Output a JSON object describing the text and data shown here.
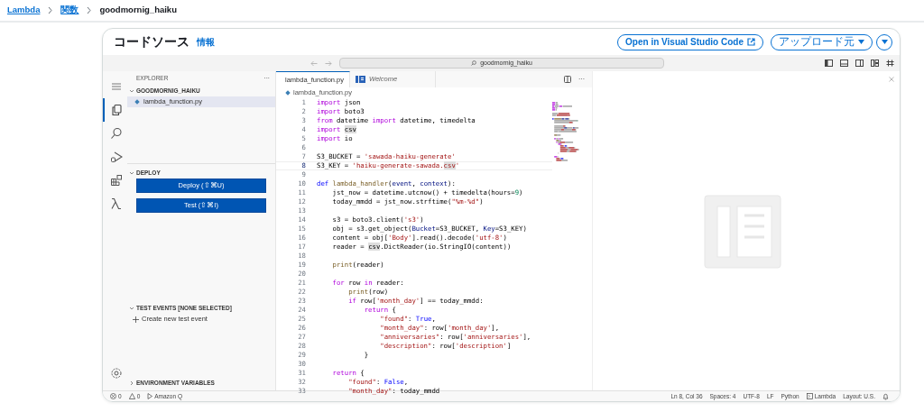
{
  "breadcrumb": [
    {
      "label": "Lambda",
      "link": true
    },
    {
      "label": "関数",
      "link": true
    },
    {
      "label": "goodmornig_haiku",
      "link": false
    }
  ],
  "panel": {
    "title": "コードソース",
    "info_link": "情報",
    "buttons": [
      {
        "kind": "external",
        "label": "Open in Visual Studio Code"
      },
      {
        "kind": "dropdown",
        "label": "アップロード元"
      },
      {
        "kind": "icon-dropdown"
      }
    ]
  },
  "ide": {
    "search": "goodmornig_haiku",
    "activity_bar": [
      {
        "kind": "menu",
        "selected": false
      },
      {
        "kind": "files",
        "selected": true
      },
      {
        "kind": "search",
        "selected": false
      },
      {
        "kind": "run",
        "selected": false
      },
      {
        "kind": "extensions",
        "selected": false
      },
      {
        "kind": "lambda",
        "selected": false
      },
      {
        "kind": "settings",
        "selected": false
      }
    ],
    "explorer": {
      "title": "EXPLORER",
      "more": "···",
      "sections": [
        {
          "kind": "files",
          "title": "GOODMORNIG_HAIKU",
          "expanded": true,
          "items": [
            {
              "label": "lambda_function.py",
              "selected": true
            }
          ]
        },
        {
          "kind": "buttons",
          "title": "DEPLOY",
          "expanded": true,
          "items": [
            {
              "label": "Deploy (⇧⌘U)"
            },
            {
              "label": "Test (⇧⌘I)"
            }
          ]
        },
        {
          "kind": "actions",
          "title": "TEST EVENTS [NONE SELECTED]",
          "expanded": true,
          "items": [
            {
              "label": "Create new test event"
            }
          ]
        },
        {
          "kind": "collapsed",
          "title": "ENVIRONMENT VARIABLES",
          "expanded": false
        }
      ]
    },
    "tabs": [
      {
        "kind": "python",
        "label": "lambda_function.py",
        "selected": true,
        "preview": false
      },
      {
        "kind": "welcome",
        "label": "Welcome",
        "selected": false,
        "preview": true
      }
    ],
    "editor_more": "···",
    "file_path": "lambda_function.py",
    "lines": [
      {
        "number": "1",
        "current": false,
        "tokens": [
          {
            "kind": "kw",
            "text": "import"
          },
          {
            "kind": "txt",
            "text": " json"
          }
        ]
      },
      {
        "number": "2",
        "current": false,
        "tokens": [
          {
            "kind": "kw",
            "text": "import"
          },
          {
            "kind": "txt",
            "text": " boto3"
          }
        ]
      },
      {
        "number": "3",
        "current": false,
        "tokens": [
          {
            "kind": "kw",
            "text": "from"
          },
          {
            "kind": "txt",
            "text": " datetime "
          },
          {
            "kind": "kw",
            "text": "import"
          },
          {
            "kind": "txt",
            "text": " datetime, timedelta"
          }
        ]
      },
      {
        "number": "4",
        "current": false,
        "tokens": [
          {
            "kind": "kw",
            "text": "import "
          },
          {
            "kind": "hl",
            "text": "csv"
          }
        ]
      },
      {
        "number": "5",
        "current": false,
        "tokens": [
          {
            "kind": "kw",
            "text": "import"
          },
          {
            "kind": "txt",
            "text": " io"
          }
        ]
      },
      {
        "number": "6",
        "current": false
      },
      {
        "number": "7",
        "current": false,
        "tokens": [
          {
            "kind": "txt",
            "text": "S3_BUCKET = "
          },
          {
            "kind": "str",
            "text": "'sawada-haiku-generate'"
          }
        ]
      },
      {
        "number": "8",
        "current": true,
        "tokens": [
          {
            "kind": "txt",
            "text": "S3_KEY = "
          },
          {
            "kind": "str",
            "text": "'haiku-generate-sawada."
          },
          {
            "kind": "hlstr",
            "text": "csv"
          },
          {
            "kind": "str",
            "text": "'"
          }
        ]
      },
      {
        "number": "9",
        "current": false
      },
      {
        "number": "10",
        "current": false,
        "tokens": [
          {
            "kind": "def",
            "text": "def "
          },
          {
            "kind": "fn",
            "text": "lambda_handler"
          },
          {
            "kind": "txt",
            "text": "("
          },
          {
            "kind": "param",
            "text": "event"
          },
          {
            "kind": "txt",
            "text": ", "
          },
          {
            "kind": "param",
            "text": "context"
          },
          {
            "kind": "txt",
            "text": "):"
          }
        ]
      },
      {
        "number": "11",
        "current": false,
        "tokens": [
          {
            "kind": "txt",
            "text": "    jst_now = datetime.utcnow() + timedelta(hours="
          },
          {
            "kind": "num",
            "text": "9"
          },
          {
            "kind": "txt",
            "text": ")"
          }
        ]
      },
      {
        "number": "12",
        "current": false,
        "tokens": [
          {
            "kind": "txt",
            "text": "    today_mmdd = jst_now.strftime("
          },
          {
            "kind": "str",
            "text": "\"%m-%d\""
          },
          {
            "kind": "txt",
            "text": ")"
          }
        ]
      },
      {
        "number": "13",
        "current": false
      },
      {
        "number": "14",
        "current": false,
        "tokens": [
          {
            "kind": "txt",
            "text": "    s3 = boto3.client("
          },
          {
            "kind": "str",
            "text": "'s3'"
          },
          {
            "kind": "txt",
            "text": ")"
          }
        ]
      },
      {
        "number": "15",
        "current": false,
        "tokens": [
          {
            "kind": "txt",
            "text": "    obj = s3.get_object("
          },
          {
            "kind": "param",
            "text": "Bucket"
          },
          {
            "kind": "txt",
            "text": "=S3_BUCKET, "
          },
          {
            "kind": "param",
            "text": "Key"
          },
          {
            "kind": "txt",
            "text": "=S3_KEY)"
          }
        ]
      },
      {
        "number": "16",
        "current": false,
        "tokens": [
          {
            "kind": "txt",
            "text": "    content = obj["
          },
          {
            "kind": "str",
            "text": "'Body'"
          },
          {
            "kind": "txt",
            "text": "].read().decode("
          },
          {
            "kind": "str",
            "text": "'utf-8'"
          },
          {
            "kind": "txt",
            "text": ")"
          }
        ]
      },
      {
        "number": "17",
        "current": false,
        "tokens": [
          {
            "kind": "txt",
            "text": "    reader = "
          },
          {
            "kind": "hl",
            "text": "csv"
          },
          {
            "kind": "txt",
            "text": ".DictReader(io.StringIO(content))"
          }
        ]
      },
      {
        "number": "18",
        "current": false
      },
      {
        "number": "19",
        "current": false,
        "tokens": [
          {
            "kind": "fn",
            "text": "    print"
          },
          {
            "kind": "txt",
            "text": "(reader)"
          }
        ]
      },
      {
        "number": "20",
        "current": false
      },
      {
        "number": "21",
        "current": false,
        "tokens": [
          {
            "kind": "kw",
            "text": "    for"
          },
          {
            "kind": "txt",
            "text": " row "
          },
          {
            "kind": "kw",
            "text": "in"
          },
          {
            "kind": "txt",
            "text": " reader:"
          }
        ]
      },
      {
        "number": "22",
        "current": false,
        "tokens": [
          {
            "kind": "fn",
            "text": "        print"
          },
          {
            "kind": "txt",
            "text": "(row)"
          }
        ]
      },
      {
        "number": "23",
        "current": false,
        "tokens": [
          {
            "kind": "kw",
            "text": "        if"
          },
          {
            "kind": "txt",
            "text": " row["
          },
          {
            "kind": "str",
            "text": "'month_day'"
          },
          {
            "kind": "txt",
            "text": "] == today_mmdd:"
          }
        ]
      },
      {
        "number": "24",
        "current": false,
        "tokens": [
          {
            "kind": "kw",
            "text": "            return"
          },
          {
            "kind": "txt",
            "text": " {"
          }
        ]
      },
      {
        "number": "25",
        "current": false,
        "tokens": [
          {
            "kind": "str",
            "text": "                \"found\""
          },
          {
            "kind": "txt",
            "text": ": "
          },
          {
            "kind": "def",
            "text": "True"
          },
          {
            "kind": "txt",
            "text": ","
          }
        ]
      },
      {
        "number": "26",
        "current": false,
        "tokens": [
          {
            "kind": "str",
            "text": "                \"month_day\""
          },
          {
            "kind": "txt",
            "text": ": row["
          },
          {
            "kind": "str",
            "text": "'month_day'"
          },
          {
            "kind": "txt",
            "text": "],"
          }
        ]
      },
      {
        "number": "27",
        "current": false,
        "tokens": [
          {
            "kind": "str",
            "text": "                \"anniversaries\""
          },
          {
            "kind": "txt",
            "text": ": row["
          },
          {
            "kind": "str",
            "text": "'anniversaries'"
          },
          {
            "kind": "txt",
            "text": "],"
          }
        ]
      },
      {
        "number": "28",
        "current": false,
        "tokens": [
          {
            "kind": "str",
            "text": "                \"description\""
          },
          {
            "kind": "txt",
            "text": ": row["
          },
          {
            "kind": "str",
            "text": "'description'"
          },
          {
            "kind": "txt",
            "text": "]"
          }
        ]
      },
      {
        "number": "29",
        "current": false,
        "tokens": [
          {
            "kind": "txt",
            "text": "            }"
          }
        ]
      },
      {
        "number": "30",
        "current": false
      },
      {
        "number": "31",
        "current": false,
        "tokens": [
          {
            "kind": "kw",
            "text": "    return"
          },
          {
            "kind": "txt",
            "text": " {"
          }
        ]
      },
      {
        "number": "32",
        "current": false,
        "tokens": [
          {
            "kind": "str",
            "text": "        \"found\""
          },
          {
            "kind": "txt",
            "text": ": "
          },
          {
            "kind": "def",
            "text": "False"
          },
          {
            "kind": "txt",
            "text": ","
          }
        ]
      },
      {
        "number": "33",
        "current": false,
        "tokens": [
          {
            "kind": "str",
            "text": "        \"month_day\""
          },
          {
            "kind": "txt",
            "text": ": today_mmdd"
          }
        ]
      }
    ],
    "status_bar": {
      "left": [
        {
          "kind": "errors",
          "text": "0"
        },
        {
          "kind": "warnings",
          "text": "0"
        },
        {
          "kind": "q",
          "text": "Amazon Q"
        }
      ],
      "right": [
        {
          "kind": "text",
          "text": "Ln 8, Col 36"
        },
        {
          "kind": "text",
          "text": "Spaces: 4"
        },
        {
          "kind": "text",
          "text": "UTF-8"
        },
        {
          "kind": "text",
          "text": "LF"
        },
        {
          "kind": "text",
          "text": "Python"
        },
        {
          "kind": "terminal",
          "text": "Lambda"
        },
        {
          "kind": "text",
          "text": "Layout: U.S."
        },
        {
          "kind": "bell"
        }
      ]
    }
  }
}
